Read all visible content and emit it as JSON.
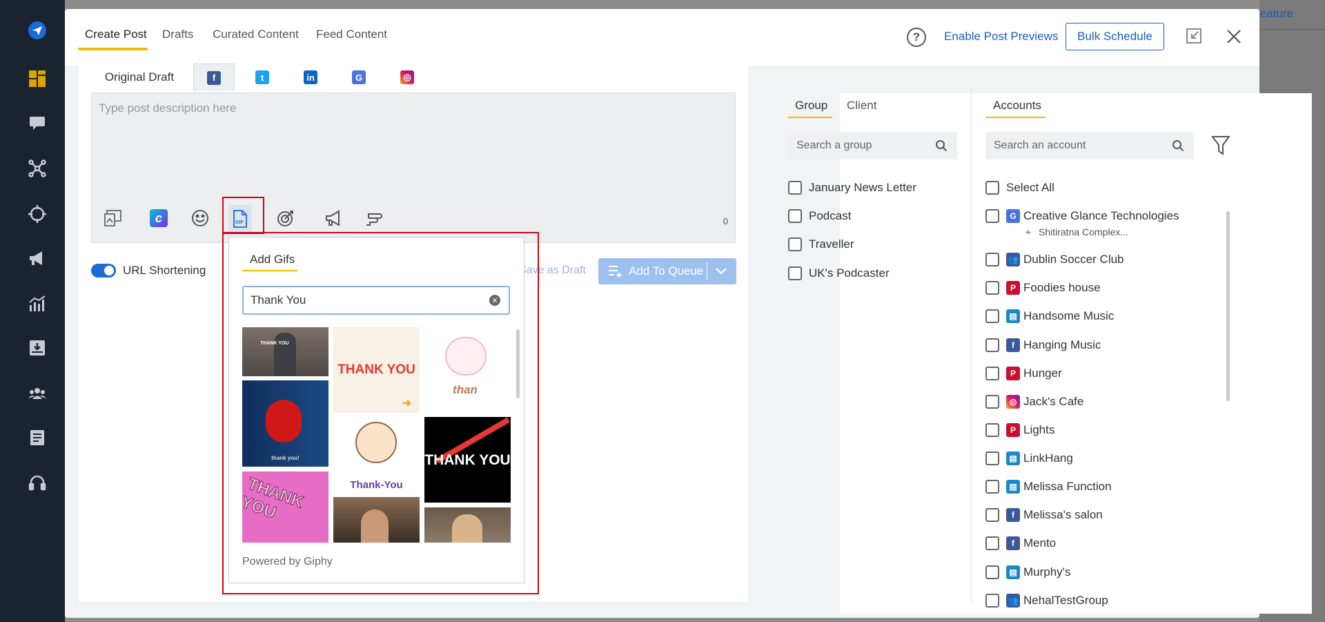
{
  "colors": {
    "accent": "#1a5fb4",
    "tab_underline": "#f5b800",
    "highlight": "#d0021b",
    "sidebar": "#1b2330"
  },
  "sidebar": {
    "icons": [
      "send-icon",
      "dashboard-icon",
      "chat-icon",
      "network-icon",
      "target-icon",
      "megaphone-icon",
      "analytics-icon",
      "inbox-icon",
      "team-icon",
      "reports-icon",
      "support-icon"
    ]
  },
  "background": {
    "link": "eature"
  },
  "header": {
    "tabs": [
      "Create Post",
      "Drafts",
      "Curated Content",
      "Feed Content"
    ],
    "enable_previews": "Enable Post Previews",
    "bulk_schedule": "Bulk Schedule",
    "help": "?"
  },
  "editor": {
    "original_draft": "Original Draft",
    "networks": [
      "facebook",
      "twitter",
      "linkedin",
      "google-business",
      "instagram"
    ],
    "placeholder": "Type post description here",
    "char_count": "0",
    "tools": [
      "media-icon",
      "canva-icon",
      "emoji-icon",
      "gif-icon",
      "target-icon",
      "megaphone-icon",
      "hand-icon"
    ]
  },
  "gif_popup": {
    "title": "Add Gifs",
    "search_value": "Thank You",
    "footer": "Powered by Giphy",
    "gif_texts": [
      "THANK YOU",
      "THANK YOU",
      "than",
      "thank you!",
      "Thank-You",
      "THANK YOU",
      "THANK YOU",
      "",
      ""
    ]
  },
  "url_shortening": {
    "label": "URL Shortening",
    "enabled": true
  },
  "actions": {
    "save_draft": "Save as Draft",
    "add_to_queue": "Add To Queue"
  },
  "groups": {
    "tabs": [
      "Group",
      "Client"
    ],
    "search_placeholder": "Search a group",
    "items": [
      "January News Letter",
      "Podcast",
      "Traveller",
      "UK's Podcaster"
    ]
  },
  "accounts": {
    "tab": "Accounts",
    "search_placeholder": "Search an account",
    "select_all": "Select All",
    "items": [
      {
        "name": "Creative Glance Technologies",
        "network": "google-business",
        "sub": "Shitiratna Complex..."
      },
      {
        "name": "Dublin Soccer Club",
        "network": "facebook-group"
      },
      {
        "name": "Foodies house",
        "network": "pinterest"
      },
      {
        "name": "Handsome Music",
        "network": "linkedin-page"
      },
      {
        "name": "Hanging Music",
        "network": "facebook"
      },
      {
        "name": "Hunger",
        "network": "pinterest"
      },
      {
        "name": "Jack's Cafe",
        "network": "instagram"
      },
      {
        "name": "Lights",
        "network": "pinterest"
      },
      {
        "name": "LinkHang",
        "network": "linkedin-page"
      },
      {
        "name": "Melissa Function",
        "network": "linkedin-page"
      },
      {
        "name": "Melissa's salon",
        "network": "facebook"
      },
      {
        "name": "Mento",
        "network": "facebook"
      },
      {
        "name": "Murphy's",
        "network": "linkedin-page"
      },
      {
        "name": "NehalTestGroup",
        "network": "facebook-group"
      }
    ]
  }
}
